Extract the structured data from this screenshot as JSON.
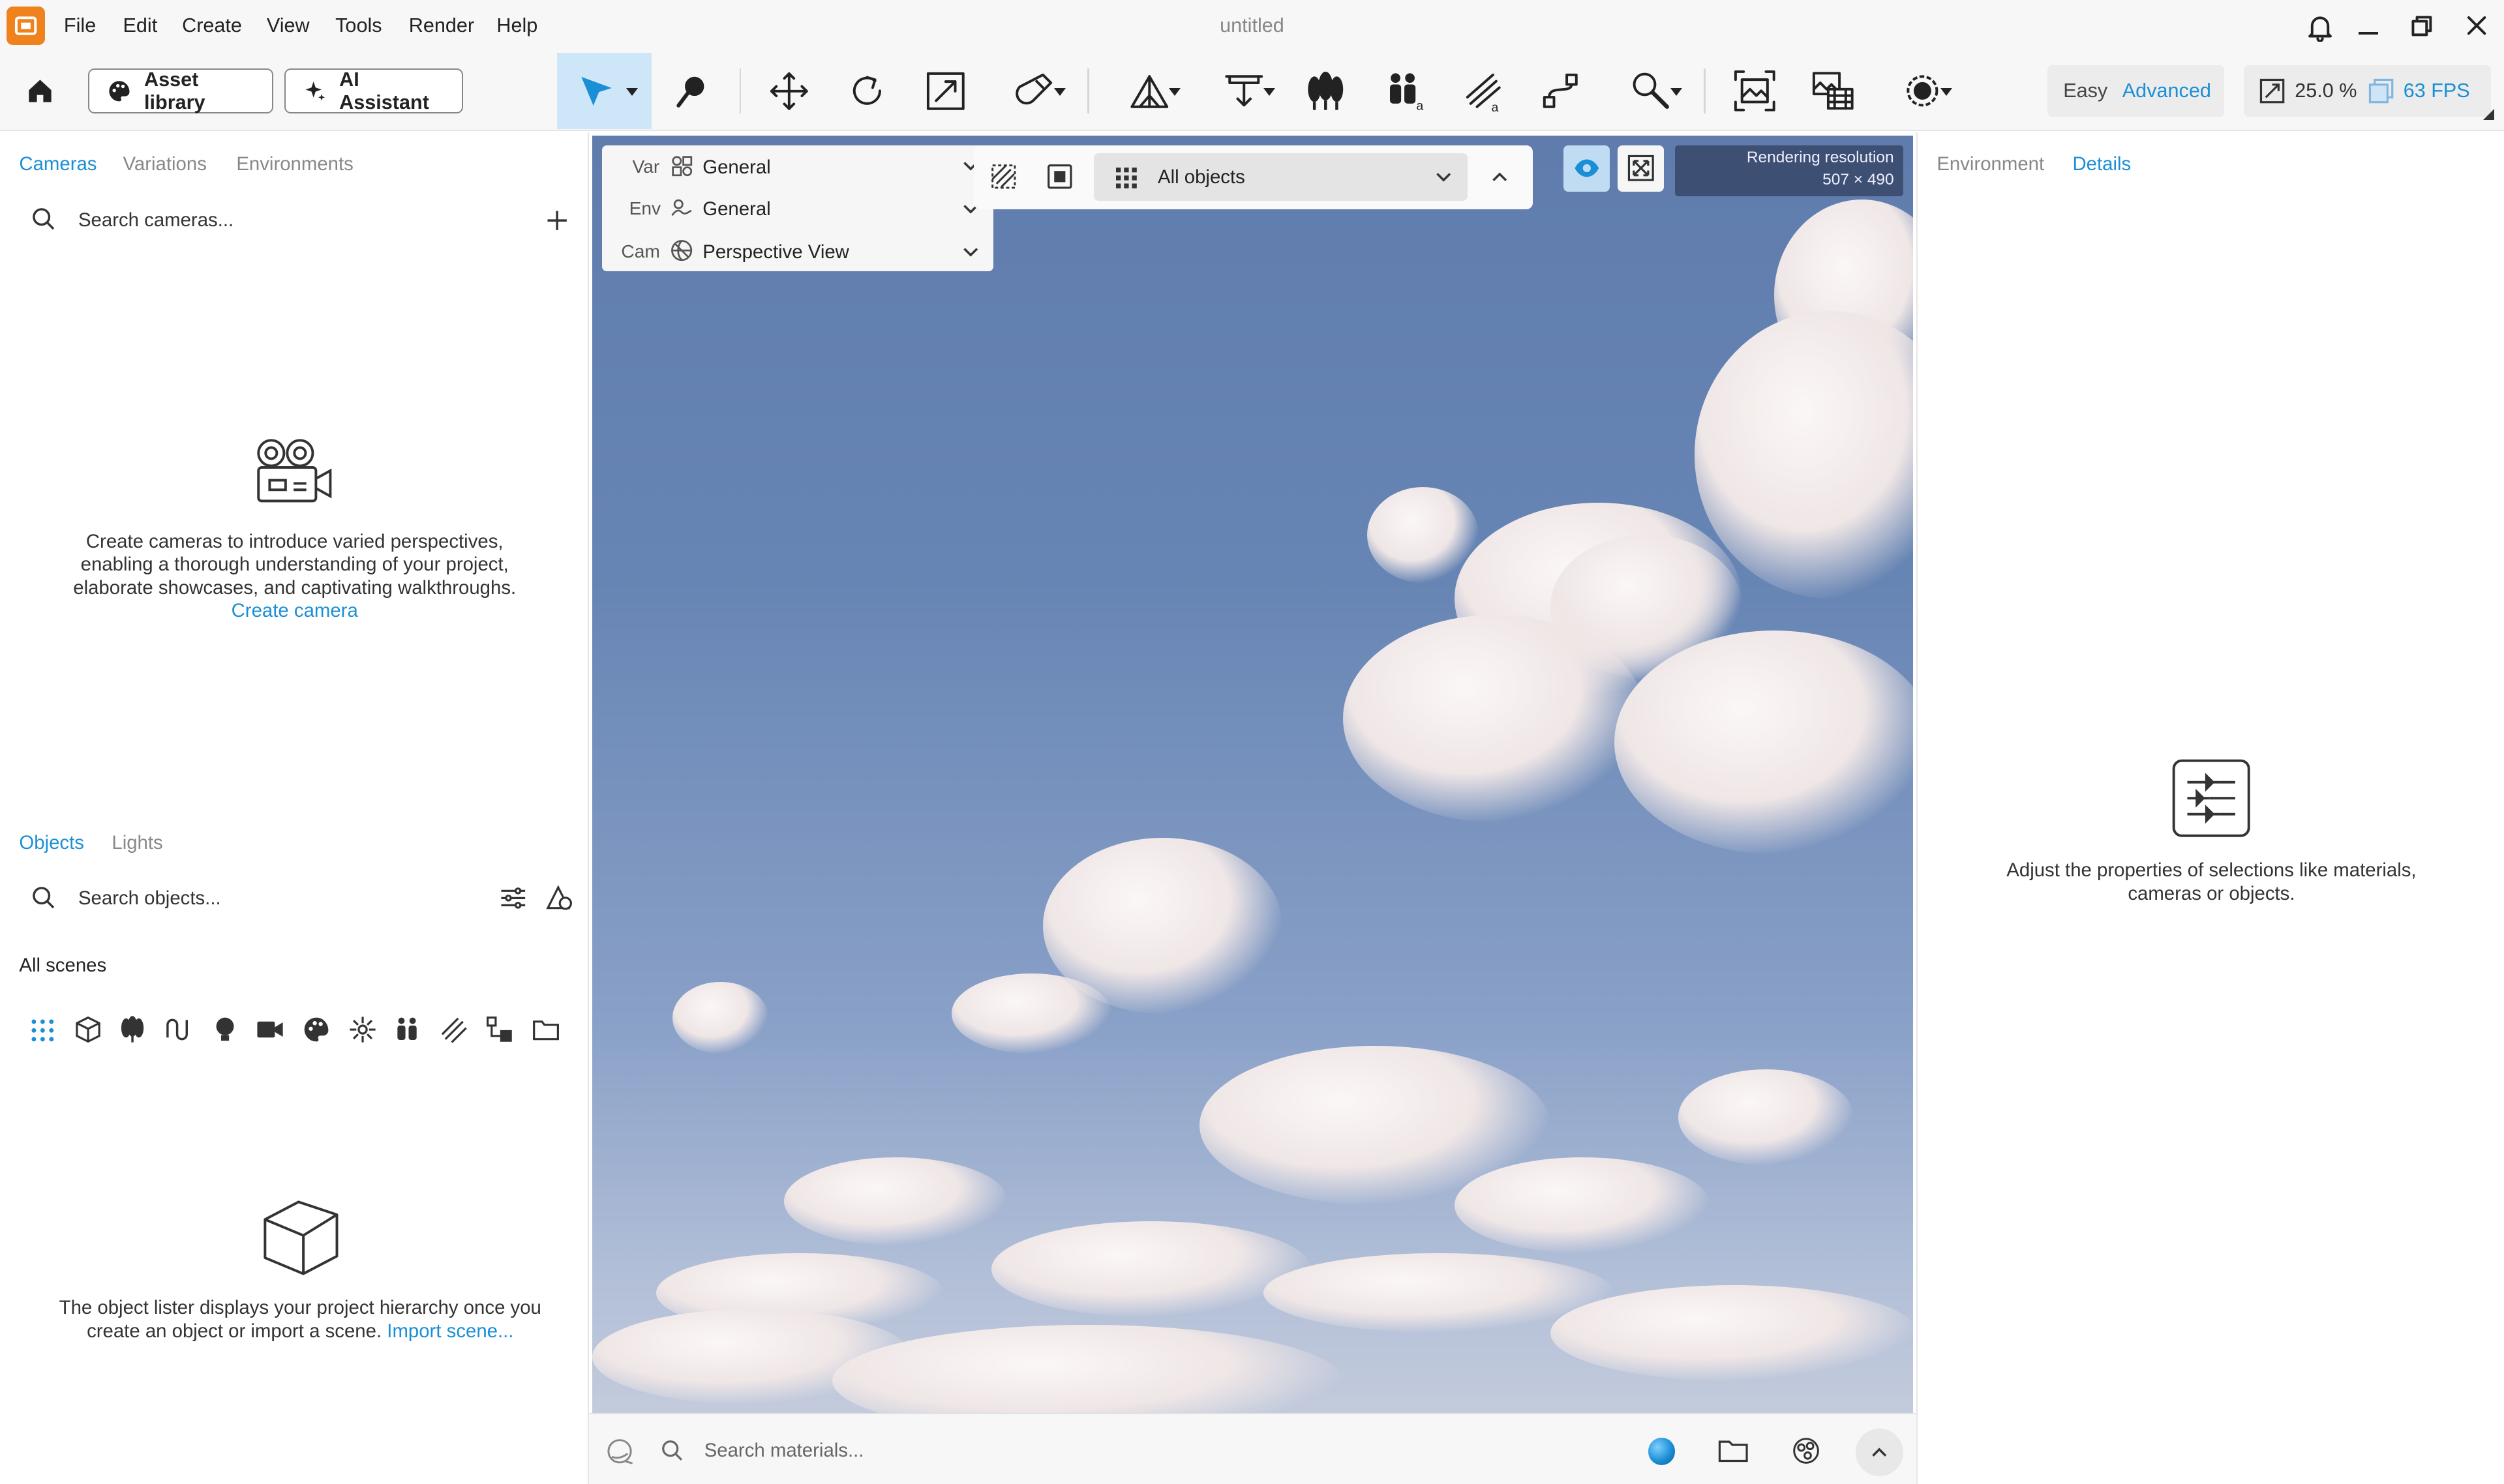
{
  "app": {
    "title": "untitled"
  },
  "menu": [
    "File",
    "Edit",
    "Create",
    "View",
    "Tools",
    "Render",
    "Help"
  ],
  "toolbar": {
    "asset_library": "Asset library",
    "ai_assistant": "AI Assistant",
    "mode_easy": "Easy",
    "mode_advanced": "Advanced",
    "render_scale": "25.0 %",
    "fps": "63 FPS"
  },
  "cameras_panel": {
    "tabs": [
      "Cameras",
      "Variations",
      "Environments"
    ],
    "search_placeholder": "Search cameras...",
    "empty_text": "Create cameras to introduce varied perspectives, enabling a thorough understanding of your project, elaborate showcases, and captivating walkthroughs.",
    "empty_text_lines": [
      "Create cameras to introduce varied perspectives,",
      "enabling a thorough understanding of your project,",
      "elaborate showcases, and captivating walkthroughs."
    ],
    "create_link": "Create camera"
  },
  "objects_panel": {
    "tabs": [
      "Objects",
      "Lights"
    ],
    "search_placeholder": "Search objects...",
    "scope": "All scenes",
    "empty_text_lines": [
      "The object lister displays your project hierarchy once you",
      "create an object or import a scene."
    ],
    "import_link": "Import scene..."
  },
  "viewport": {
    "var_label": "Var",
    "var_value": "General",
    "env_label": "Env",
    "env_value": "General",
    "cam_label": "Cam",
    "cam_value": "Perspective View",
    "filter_value": "All objects",
    "resolution_label": "Rendering resolution",
    "resolution_value": "507 × 490"
  },
  "right_panel": {
    "tabs": [
      "Environment",
      "Details"
    ],
    "empty_text_lines": [
      "Adjust the properties of selections like materials,",
      "cameras or objects."
    ]
  },
  "material_bar": {
    "search_placeholder": "Search materials..."
  },
  "colors": {
    "accent": "#1b8fd6",
    "brand": "#f0821e",
    "select_bg": "#cde6f8",
    "res_bg": "#3d4f73"
  }
}
